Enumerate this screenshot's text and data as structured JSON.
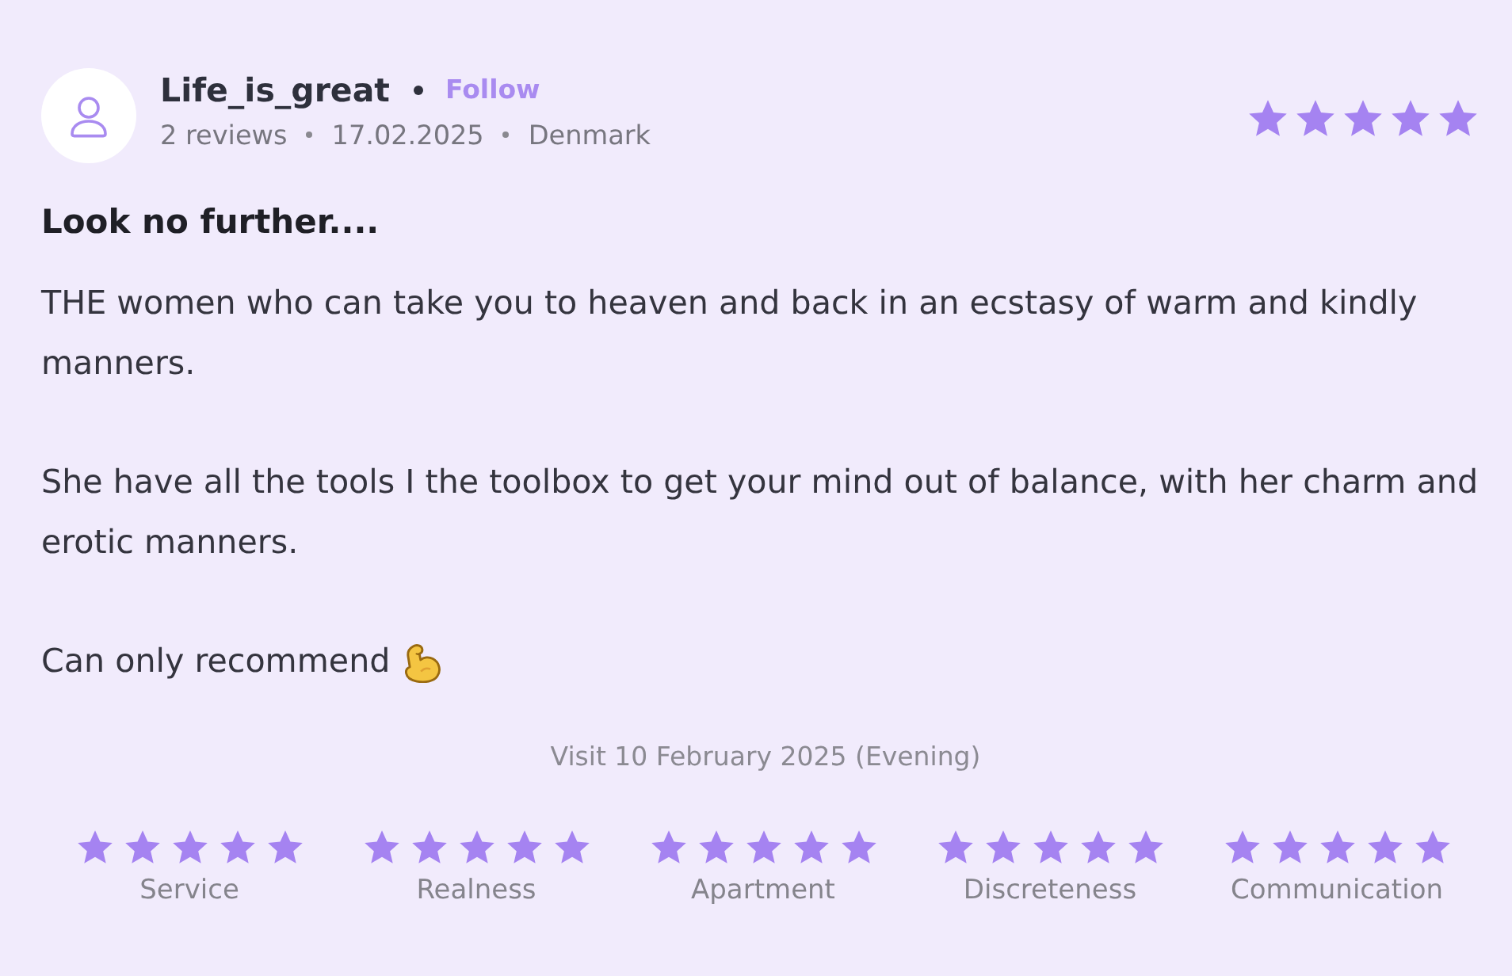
{
  "author": {
    "name": "Life_is_great",
    "follow": "Follow",
    "reviews": "2 reviews",
    "date": "17.02.2025",
    "country": "Denmark"
  },
  "rating": {
    "stars": 5
  },
  "title": "Look no further....",
  "paragraphs": [
    {
      "text": "THE women who can take you to heaven and back in an ecstasy of warm and kindly manners.",
      "emoji": false
    },
    {
      "text": "She have all the tools I the toolbox to get your mind out of balance, with her charm and erotic manners.",
      "emoji": false
    },
    {
      "text": "Can only recommend",
      "emoji": true
    }
  ],
  "visit": "Visit 10 February 2025 (Evening)",
  "ratings": [
    {
      "label": "Service",
      "stars": 5
    },
    {
      "label": "Realness",
      "stars": 5
    },
    {
      "label": "Apartment",
      "stars": 5
    },
    {
      "label": "Discreteness",
      "stars": 5
    },
    {
      "label": "Communication",
      "stars": 5
    }
  ]
}
